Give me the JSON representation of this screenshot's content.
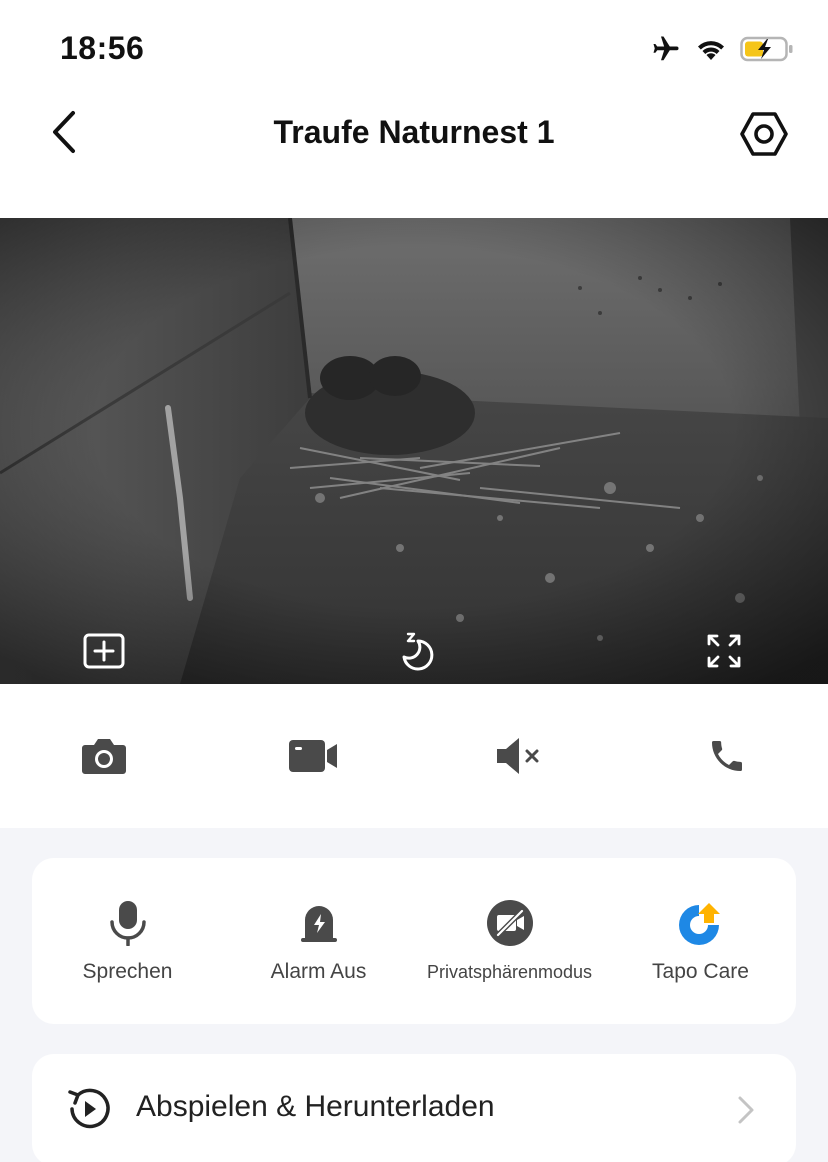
{
  "status_bar": {
    "time": "18:56",
    "icons": [
      "airplane-icon",
      "wifi-icon",
      "battery-charging-icon"
    ]
  },
  "header": {
    "title": "Traufe Naturnest 1",
    "back_icon": "chevron-left-icon",
    "settings_icon": "settings-hexagon-icon"
  },
  "video": {
    "controls": [
      "add-view-icon",
      "night-mode-icon",
      "fullscreen-icon"
    ]
  },
  "actions": [
    "camera-icon",
    "record-video-icon",
    "speaker-muted-icon",
    "phone-icon"
  ],
  "features": [
    {
      "label": "Sprechen",
      "icon": "microphone-icon"
    },
    {
      "label": "Alarm Aus",
      "icon": "alarm-icon"
    },
    {
      "label": "Privatsphärenmodus",
      "icon": "privacy-mode-icon"
    },
    {
      "label": "Tapo Care",
      "icon": "tapo-care-icon"
    }
  ],
  "playback": {
    "label": "Abspielen & Herunterladen",
    "icon": "playback-history-icon"
  },
  "colors": {
    "accent_blue": "#1e88e5",
    "accent_yellow": "#ffb300",
    "battery_yellow": "#f5c518",
    "icon_gray": "#4a4a4a",
    "background": "#f4f5f9"
  }
}
